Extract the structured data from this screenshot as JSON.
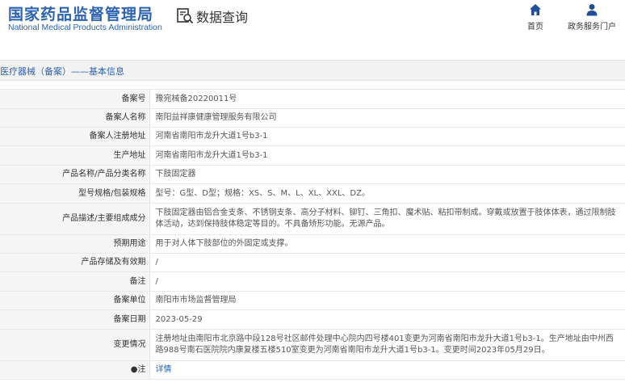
{
  "header": {
    "logo_cn": "国家药品监督管理局",
    "logo_en": "National Medical Products Administration",
    "query_title": "数据查询",
    "nav": [
      {
        "label": "首页",
        "icon": "home-icon"
      },
      {
        "label": "政务服务门户",
        "icon": "user-icon"
      }
    ]
  },
  "section_title": "医疗器械（备案）——基本信息",
  "rows": [
    {
      "label": "备案号",
      "value": "豫宛械备20220011号"
    },
    {
      "label": "备案人名称",
      "value": "南阳益祥康健康管理服务有限公司"
    },
    {
      "label": "备案人注册地址",
      "value": "河南省南阳市龙升大道1号b3-1"
    },
    {
      "label": "生产地址",
      "value": "河南省南阳市龙升大道1号b3-1"
    },
    {
      "label": "产品名称/产品分类名称",
      "value": "下肢固定器"
    },
    {
      "label": "型号规格/包装规格",
      "value": "型号：G型、D型；规格：XS、S、M、L、XL、XXL、DZ。"
    },
    {
      "label": "产品描述/主要组成成分",
      "value": "下肢固定器由铝合金支条、不锈钢支条、高分子材料、铆钉、三角扣、魔术贴、粘扣带制成。穿戴或放置于肢体体表，通过限制肢体活动，达到保持肢体稳定等目的。不具备矫形功能。无源产品。"
    },
    {
      "label": "预期用途",
      "value": "用于对人体下肢部位的外固定或支撑。"
    },
    {
      "label": "产品存储及有效期",
      "value": "/"
    },
    {
      "label": "备注",
      "value": "/"
    },
    {
      "label": "备案单位",
      "value": "南阳市市场监督管理局"
    },
    {
      "label": "备案日期",
      "value": "2023-05-29"
    },
    {
      "label": "变更情况",
      "value": "注册地址由南阳市北京路中段128号社区邮件处理中心院内四号楼401变更为河南省南阳市龙升大道1号b3-1。生产地址由中州西路988号南石医院院内康复楼五楼510室变更为河南省南阳市龙升大道1号b3-1。变更时间2023年05月29日。"
    },
    {
      "label": "●注",
      "value": "详情"
    }
  ]
}
